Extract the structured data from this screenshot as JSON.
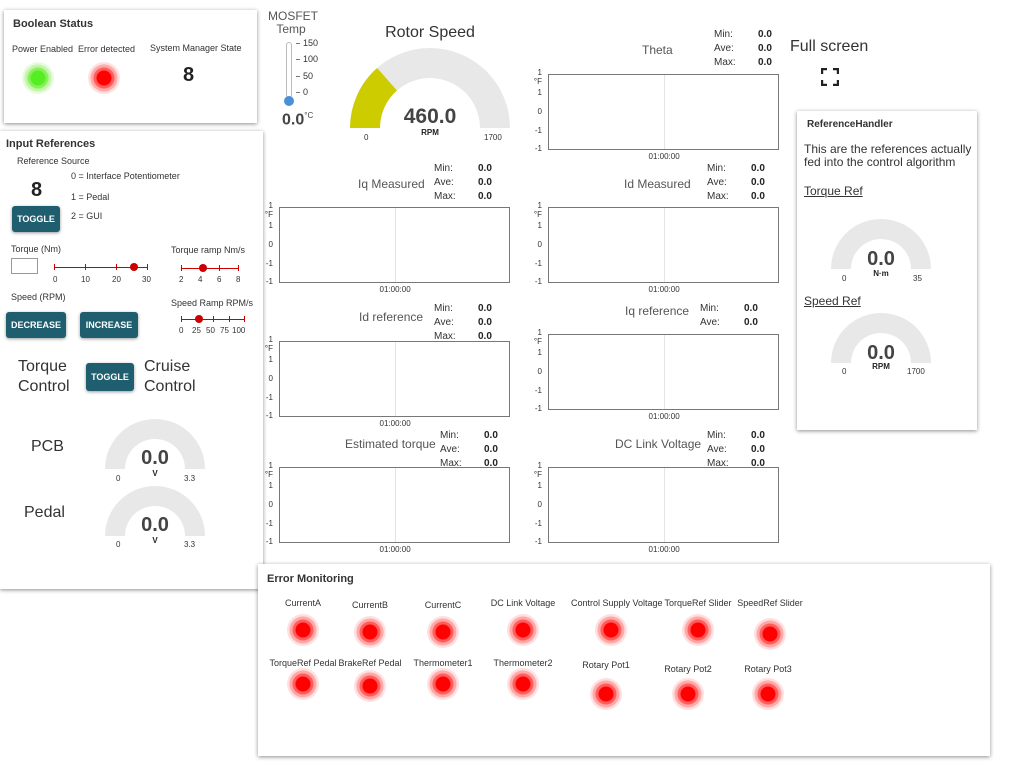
{
  "boolean_status": {
    "title": "Boolean Status",
    "power_label": "Power Enabled",
    "error_label": "Error detected",
    "sm_label": "System Manager State",
    "sm_value": "8",
    "colors": {
      "on": "#55ee22",
      "error": "#ff0000"
    }
  },
  "mosfet": {
    "title": "MOSFET\nTemp",
    "ticks": [
      "150",
      "100",
      "50",
      "0"
    ],
    "value": "0.0",
    "unit": "°C"
  },
  "rotor_speed": {
    "title": "Rotor Speed",
    "value": "460.0",
    "unit": "RPM",
    "min": "0",
    "max": "1700",
    "fraction": 0.27,
    "color": "#cccc00"
  },
  "fullscreen": {
    "label": "Full screen"
  },
  "input_refs": {
    "title": "Input References",
    "ref_source_label": "Reference Source",
    "ref_source_value": "8",
    "toggle": "TOGGLE",
    "options": [
      "0 = Interface Potentiometer",
      "1 = Pedal",
      "2 = GUI"
    ],
    "torque_label": "Torque (Nm)",
    "torque_ticks": [
      "0",
      "10",
      "20",
      "30"
    ],
    "torque_value": 26,
    "torque_ramp_label": "Torque ramp Nm/s",
    "torque_ramp_ticks": [
      "2",
      "4",
      "6",
      "8"
    ],
    "torque_ramp_value": 4.2,
    "speed_label": "Speed (RPM)",
    "decrease": "DECREASE",
    "increase": "INCREASE",
    "speed_ramp_label": "Speed Ramp RPM/s",
    "speed_ramp_ticks": [
      "0",
      "25",
      "50",
      "75",
      "100"
    ],
    "speed_ramp_value": 20,
    "mode_left": "Torque\nControl",
    "mode_toggle": "TOGGLE",
    "mode_right": "Cruise\nControl",
    "pcb_label": "PCB",
    "pedal_label": "Pedal",
    "pcb_gauge": {
      "value": "0.0",
      "unit": "V",
      "min": "0",
      "max": "3.3"
    },
    "pedal_gauge": {
      "value": "0.0",
      "unit": "V",
      "min": "0",
      "max": "3.3"
    }
  },
  "charts": [
    {
      "id": "theta",
      "title": "Theta",
      "min": "0.0",
      "ave": "0.0",
      "max": "0.0",
      "has_max": true,
      "xlabel": "01:00:00",
      "yticks": [
        "1 °F",
        "1",
        "0",
        "-1",
        "-1"
      ]
    },
    {
      "id": "iq_measured",
      "title": "Iq Measured",
      "min": "0.0",
      "ave": "0.0",
      "max": "0.0",
      "has_max": true,
      "xlabel": "01:00:00",
      "yticks": [
        "1 °F",
        "1",
        "0",
        "-1",
        "-1"
      ]
    },
    {
      "id": "id_measured",
      "title": "Id Measured",
      "min": "0.0",
      "ave": "0.0",
      "max": "0.0",
      "has_max": true,
      "xlabel": "01:00:00",
      "yticks": [
        "1 °F",
        "1",
        "0",
        "-1",
        "-1"
      ]
    },
    {
      "id": "id_reference",
      "title": "Id reference",
      "min": "0.0",
      "ave": "0.0",
      "max": "0.0",
      "has_max": true,
      "xlabel": "01:00:00",
      "yticks": [
        "1 °F",
        "1",
        "0",
        "-1",
        "-1"
      ]
    },
    {
      "id": "iq_reference",
      "title": "Iq reference",
      "min": "0.0",
      "ave": "0.0",
      "max": "",
      "has_max": false,
      "xlabel": "01:00:00",
      "yticks": [
        "1 °F",
        "1",
        "0",
        "-1",
        "-1"
      ]
    },
    {
      "id": "est_torque",
      "title": "Estimated torque",
      "min": "0.0",
      "ave": "0.0",
      "max": "0.0",
      "has_max": true,
      "xlabel": "01:00:00",
      "yticks": [
        "1 °F",
        "1",
        "0",
        "-1",
        "-1"
      ]
    },
    {
      "id": "dc_link",
      "title": "DC Link Voltage",
      "min": "0.0",
      "ave": "0.0",
      "max": "0.0",
      "has_max": true,
      "xlabel": "01:00:00",
      "yticks": [
        "1 °F",
        "1",
        "0",
        "-1",
        "-1"
      ]
    }
  ],
  "stat_labels": {
    "min": "Min:",
    "ave": "Ave:",
    "max": "Max:"
  },
  "ref_handler": {
    "title": "ReferenceHandler",
    "desc": "This are the references actually fed into the control algorithm",
    "torque_ref": "Torque Ref",
    "speed_ref": "Speed Ref",
    "torque_gauge": {
      "value": "0.0",
      "unit": "N·m",
      "min": "0",
      "max": "35"
    },
    "speed_gauge": {
      "value": "0.0",
      "unit": "RPM",
      "min": "0",
      "max": "1700"
    }
  },
  "error_monitoring": {
    "title": "Error Monitoring",
    "row1": [
      "CurrentA",
      "CurrentB",
      "CurrentC",
      "DC Link Voltage",
      "Control Supply Voltage",
      "TorqueRef Slider",
      "SpeedRef Slider"
    ],
    "row2": [
      "TorqueRef Pedal",
      "BrakeRef Pedal",
      "Thermometer1",
      "Thermometer2",
      "Rotary Pot1",
      "Rotary Pot2",
      "Rotary Pot3"
    ]
  }
}
